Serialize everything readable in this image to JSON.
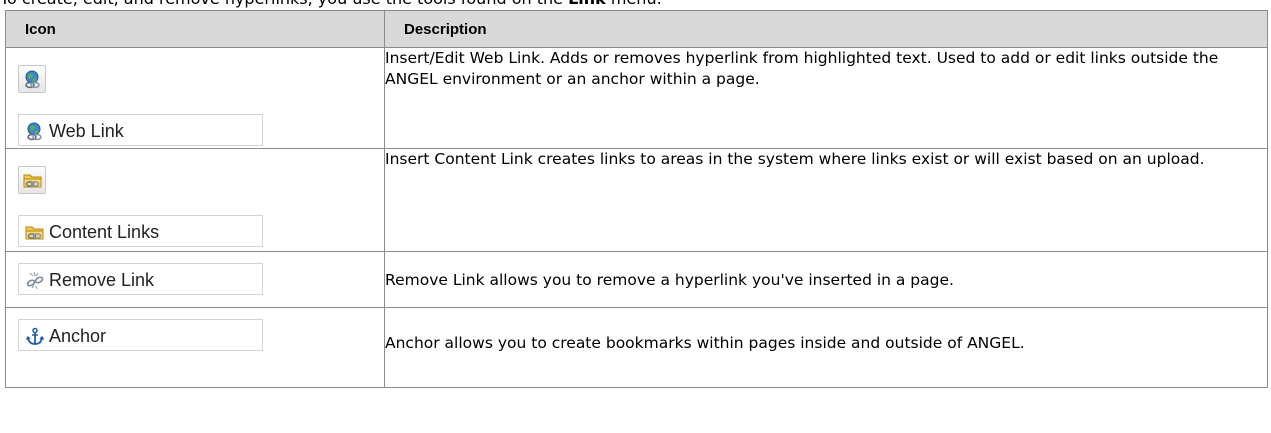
{
  "intro": {
    "before": "To create, edit, and remove hyperlinks, you use the tools found on the ",
    "bold": "Link",
    "after": " menu."
  },
  "table": {
    "headers": {
      "icon": "Icon",
      "description": "Description"
    },
    "rows": [
      {
        "icon": "globe-link-icon",
        "label": "Web Link",
        "description": "Insert/Edit Web Link. Adds or removes hyperlink from highlighted text. Used to add or edit links outside the ANGEL environment or an anchor within a page."
      },
      {
        "icon": "folder-link-icon",
        "label": "Content Links",
        "description": "Insert Content Link creates links to areas in the system where links exist or will exist based on an upload."
      },
      {
        "icon": "broken-link-icon",
        "label": "Remove Link",
        "description": "Remove Link allows you to remove a hyperlink you've inserted in a page."
      },
      {
        "icon": "anchor-icon",
        "label": "Anchor",
        "description": "Anchor allows you to create bookmarks within pages inside and outside of ANGEL."
      }
    ]
  },
  "colors": {
    "header_bg": "#d9d9d9",
    "border": "#8c8c8c",
    "anchor_blue": "#1f5fa8"
  }
}
